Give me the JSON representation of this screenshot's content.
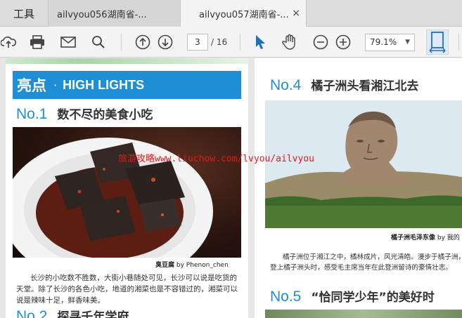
{
  "tabs": {
    "tools_label": "工具",
    "tab1_label": "ailvyou056湖南省-...",
    "tab2_label": "ailvyou057湖南省-...",
    "close_glyph": "×"
  },
  "toolbar": {
    "current_page": "3",
    "total_pages": "/ 16",
    "zoom_level": "79.1%",
    "zoom_caret": "▼"
  },
  "document": {
    "highlights": {
      "cn": "亮点",
      "dot": "·",
      "en": "HIGH LIGHTS"
    },
    "item1": {
      "num": "No.1",
      "title": "数不尽的美食小吃"
    },
    "photo1_caption": {
      "name": "臭豆腐",
      "credit": "by Phenon_chen"
    },
    "item1_text": "长沙的小吃数不胜数，大街小巷随处可见，长沙可以说是吃货的天堂。除了长沙的各色小吃，地道的湘菜也是不容错过的，湘菜可以说是辣味十足，鲜香味美。",
    "item2": {
      "num": "No.2",
      "title": "探寻千年学府"
    },
    "item4": {
      "num": "No.4",
      "title": "橘子洲头看湘江北去"
    },
    "photo2_caption": {
      "name": "橘子洲毛泽东像",
      "credit": "by 我的"
    },
    "item4_text": "橘子洲位于湘江之中，橘林成片，风光清皓。漫步于橘子洲，登上橘子洲头时，感受毛主席当年在此登洲留诗的豪情壮志。",
    "item5": {
      "num": "No.5",
      "title": "“恰同学少年”的美好时"
    },
    "watermark": "旅游攻略www.liuchow.com/lvyou/ailvyou"
  },
  "colors": {
    "accent": "#1e8ed6",
    "watermark": "#e21a1a"
  }
}
